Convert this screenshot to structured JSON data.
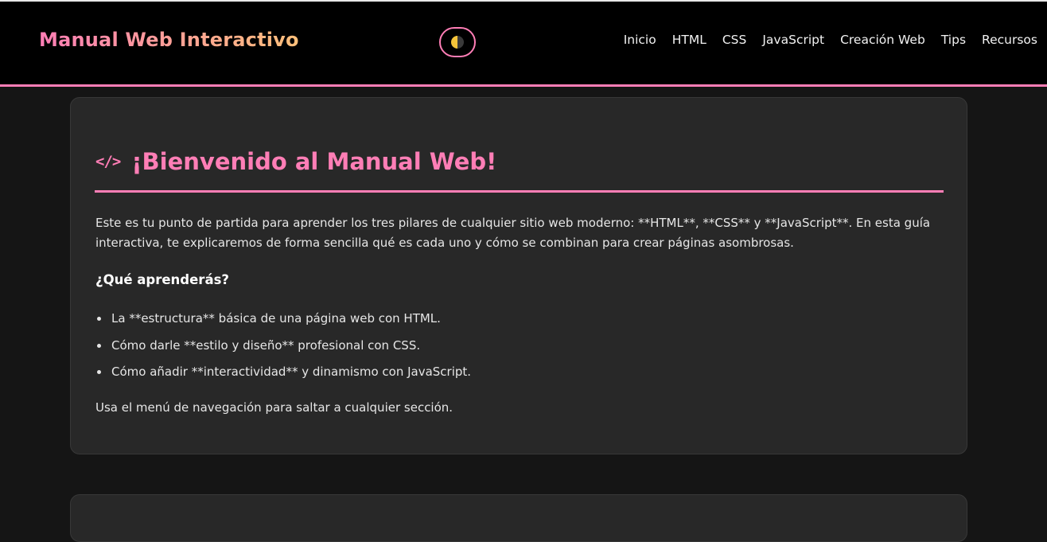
{
  "header": {
    "brand": "Manual Web Interactivo",
    "theme_toggle_icon": "half-moon-icon",
    "nav": [
      "Inicio",
      "HTML",
      "CSS",
      "JavaScript",
      "Creación Web",
      "Tips",
      "Recursos"
    ]
  },
  "colors": {
    "accent": "#ff7eb6",
    "accent_secondary": "#ffc07a",
    "background": "#151515",
    "card": "#282828",
    "header": "#000000"
  },
  "welcome": {
    "icon": "code-icon",
    "icon_glyph": "</>",
    "title": "¡Bienvenido al Manual Web!",
    "intro": "Este es tu punto de partida para aprender los tres pilares de cualquier sitio web moderno: **HTML**, **CSS** y **JavaScript**. En esta guía interactiva, te explicaremos de forma sencilla qué es cada uno y cómo se combinan para crear páginas asombrosas.",
    "subheading": "¿Qué aprenderás?",
    "items": [
      "La **estructura** básica de una página web con HTML.",
      "Cómo darle **estilo y diseño** profesional con CSS.",
      "Cómo añadir **interactividad** y dinamismo con JavaScript."
    ],
    "outro": "Usa el menú de navegación para saltar a cualquier sección."
  }
}
